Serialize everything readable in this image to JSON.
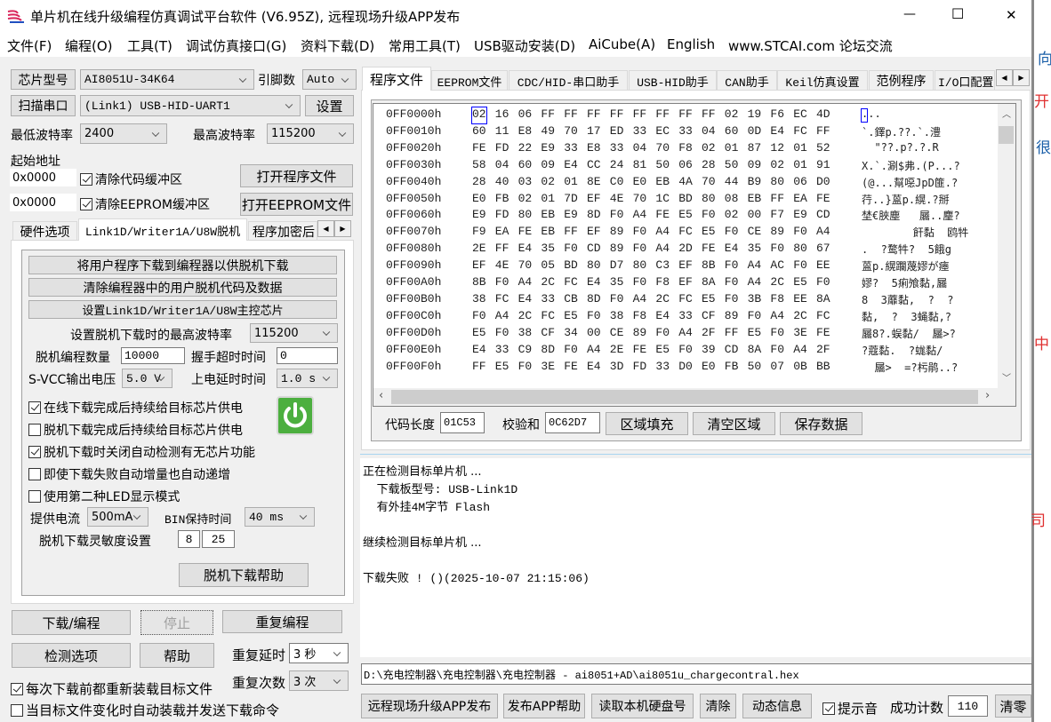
{
  "titlebar": {
    "title": "单片机在线升级编程仿真调试平台软件 (V6.95Z), 远程现场升级APP发布",
    "minimize": "—",
    "maximize": "☐",
    "close": "✕"
  },
  "menu": [
    "文件(F)",
    "编程(O)",
    "工具(T)",
    "调试仿真接口(G)",
    "资料下载(D)",
    "常用工具(T)",
    "USB驱动安装(D)",
    "AiCube(A)",
    "English",
    "www.STCAI.com 论坛交流"
  ],
  "left": {
    "chip_btn": "芯片型号",
    "chip_value": "AI8051U-34K64",
    "pins_label": "引脚数",
    "pins_value": "Auto",
    "scan_btn": "扫描串口",
    "port_value": "(Link1) USB-HID-UART1",
    "settings_btn": "设置",
    "min_baud_label": "最低波特率",
    "min_baud": "2400",
    "max_baud_label": "最高波特率",
    "max_baud": "115200",
    "start_addr_label": "起始地址",
    "code_addr": "0x0000",
    "clear_code": "清除代码缓冲区",
    "open_prog": "打开程序文件",
    "eeprom_addr": "0x0000",
    "clear_eeprom": "清除EEPROM缓冲区",
    "open_eeprom": "打开EEPROM文件",
    "tabs": [
      "硬件选项",
      "Link1D/Writer1A/U8W脱机",
      "程序加密后"
    ],
    "offline": {
      "btn1": "将用户程序下载到编程器以供脱机下载",
      "btn2": "清除编程器中的用户脱机代码及数据",
      "btn3": "设置Link1D/Writer1A/U8W主控芯片",
      "max_baud_label": "设置脱机下载时的最高波特率",
      "max_baud": "115200",
      "count_label": "脱机编程数量",
      "count": "10000",
      "handshake_label": "握手超时时间",
      "handshake": "0",
      "svcc_label": "S-VCC输出电压",
      "svcc": "5.0 V",
      "delay_label": "上电延时时间",
      "delay": "1.0 s",
      "checks": [
        {
          "label": "在线下载完成后持续给目标芯片供电",
          "checked": true
        },
        {
          "label": "脱机下载完成后持续给目标芯片供电",
          "checked": false
        },
        {
          "label": "脱机下载时关闭自动检测有无芯片功能",
          "checked": true
        },
        {
          "label": "即使下载失败自动增量也自动递增",
          "checked": false
        },
        {
          "label": "使用第二种LED显示模式",
          "checked": false
        }
      ],
      "current_label": "提供电流",
      "current": "500mA",
      "bin_label": "BIN保持时间",
      "bin": "40 ms",
      "sens_label": "脱机下载灵敏度设置",
      "sens1": "8",
      "sens2": "25",
      "help": "脱机下载帮助"
    },
    "download": "下载/编程",
    "stop": "停止",
    "repeat": "重复编程",
    "detect": "检测选项",
    "help": "帮助",
    "repeat_delay_label": "重复延时",
    "repeat_delay": "3 秒",
    "repeat_count_label": "重复次数",
    "repeat_count": "3 次",
    "reload": {
      "label": "每次下载前都重新装载目标文件",
      "checked": true
    },
    "auto_send": {
      "label": "当目标文件变化时自动装载并发送下载命令",
      "checked": false
    }
  },
  "right": {
    "tabs": [
      "程序文件",
      "EEPROM文件",
      "CDC/HID-串口助手",
      "USB-HID助手",
      "CAN助手",
      "Keil仿真设置",
      "范例程序",
      "I/O口配置"
    ],
    "hex": [
      {
        "addr": "0FF0000h",
        "bytes": [
          "02",
          "16",
          "06",
          "FF",
          "FF",
          "FF",
          "FF",
          "FF",
          "FF",
          "FF",
          "FF",
          "02",
          "19",
          "F6",
          "EC",
          "4D"
        ],
        "ascii": "..."
      },
      {
        "addr": "0FF0010h",
        "bytes": [
          "60",
          "11",
          "E8",
          "49",
          "70",
          "17",
          "ED",
          "33",
          "EC",
          "33",
          "04",
          "60",
          "0D",
          "E4",
          "FC",
          "FF"
        ],
        "ascii": "`.鐸p.??.`.澧"
      },
      {
        "addr": "0FF0020h",
        "bytes": [
          "FE",
          "FD",
          "22",
          "E9",
          "33",
          "E8",
          "33",
          "04",
          "70",
          "F8",
          "02",
          "01",
          "87",
          "12",
          "01",
          "52"
        ],
        "ascii": "  \"??.p?.?.R"
      },
      {
        "addr": "0FF0030h",
        "bytes": [
          "58",
          "04",
          "60",
          "09",
          "E4",
          "CC",
          "24",
          "81",
          "50",
          "06",
          "28",
          "50",
          "09",
          "02",
          "01",
          "91"
        ],
        "ascii": "X.`.涮$弗.(P...?"
      },
      {
        "addr": "0FF0040h",
        "bytes": [
          "28",
          "40",
          "03",
          "02",
          "01",
          "8E",
          "C0",
          "E0",
          "EB",
          "4A",
          "70",
          "44",
          "B9",
          "80",
          "06",
          "D0"
        ],
        "ascii": "(@...幫噁JpD篚.?"
      },
      {
        "addr": "0FF0050h",
        "bytes": [
          "E0",
          "FB",
          "02",
          "01",
          "7D",
          "EF",
          "4E",
          "70",
          "1C",
          "BD",
          "80",
          "08",
          "EB",
          "FF",
          "EA",
          "FE"
        ],
        "ascii": "荇..}蒕p.縨.?掰"
      },
      {
        "addr": "0FF0060h",
        "bytes": [
          "E9",
          "FD",
          "80",
          "EB",
          "E9",
          "8D",
          "F0",
          "A4",
          "FE",
          "E5",
          "F0",
          "02",
          "00",
          "F7",
          "E9",
          "CD"
        ],
        "ascii": "埜€脥塵   屫..麈?"
      },
      {
        "addr": "0FF0070h",
        "bytes": [
          "F9",
          "EA",
          "FE",
          "EB",
          "FF",
          "EF",
          "89",
          "F0",
          "A4",
          "FC",
          "E5",
          "F0",
          "CE",
          "89",
          "F0",
          "A4"
        ],
        "ascii": "        飦黏  鸥牪"
      },
      {
        "addr": "0FF0080h",
        "bytes": [
          "2E",
          "FF",
          "E4",
          "35",
          "F0",
          "CD",
          "89",
          "F0",
          "A4",
          "2D",
          "FE",
          "E4",
          "35",
          "F0",
          "80",
          "67"
        ],
        "ascii": ".  ?鹜牪?  5餓g"
      },
      {
        "addr": "0FF0090h",
        "bytes": [
          "EF",
          "4E",
          "70",
          "05",
          "BD",
          "80",
          "D7",
          "80",
          "C3",
          "EF",
          "8B",
          "F0",
          "A4",
          "AC",
          "F0",
          "EE"
        ],
        "ascii": "蒕p.縨躝蔑嫪が瘗"
      },
      {
        "addr": "0FF00A0h",
        "bytes": [
          "8B",
          "F0",
          "A4",
          "2C",
          "FC",
          "E4",
          "35",
          "F0",
          "F8",
          "EF",
          "8A",
          "F0",
          "A4",
          "2C",
          "E5",
          "F0"
        ],
        "ascii": "嫪?  5痢飧黏,屫"
      },
      {
        "addr": "0FF00B0h",
        "bytes": [
          "38",
          "FC",
          "E4",
          "33",
          "CB",
          "8D",
          "F0",
          "A4",
          "2C",
          "FC",
          "E5",
          "F0",
          "3B",
          "F8",
          "EE",
          "8A"
        ],
        "ascii": "8  3蘼黏,  ?  ?"
      },
      {
        "addr": "0FF00C0h",
        "bytes": [
          "F0",
          "A4",
          "2C",
          "FC",
          "E5",
          "F0",
          "38",
          "F8",
          "E4",
          "33",
          "CF",
          "89",
          "F0",
          "A4",
          "2C",
          "FC"
        ],
        "ascii": "黏,  ?  3蝇黏,?"
      },
      {
        "addr": "0FF00D0h",
        "bytes": [
          "E5",
          "F0",
          "38",
          "CF",
          "34",
          "00",
          "CE",
          "89",
          "F0",
          "A4",
          "2F",
          "FF",
          "E5",
          "F0",
          "3E",
          "FE"
        ],
        "ascii": "屫8?.蜈黏/  屫>?"
      },
      {
        "addr": "0FF00E0h",
        "bytes": [
          "E4",
          "33",
          "C9",
          "8D",
          "F0",
          "A4",
          "2E",
          "FE",
          "E5",
          "F0",
          "39",
          "CD",
          "8A",
          "F0",
          "A4",
          "2F"
        ],
        "ascii": "?蔻黏.  ?蛖黏/"
      },
      {
        "addr": "0FF00F0h",
        "bytes": [
          "FF",
          "E5",
          "F0",
          "3E",
          "FE",
          "E4",
          "3D",
          "FD",
          "33",
          "D0",
          "E0",
          "FB",
          "50",
          "07",
          "0B",
          "BB"
        ],
        "ascii": "  屫>  =?杇鹃..?"
      }
    ],
    "code_len_label": "代码长度",
    "code_len": "01C53",
    "checksum_label": "校验和",
    "checksum": "0C62D7",
    "fill_btn": "区域填充",
    "clear_btn": "清空区域",
    "save_btn": "保存数据",
    "log": [
      "正在检测目标单片机 ...",
      "  下载板型号: USB-Link1D",
      "  有外挂4M字节 Flash",
      "",
      "继续检测目标单片机 ...",
      "",
      "下载失败 ! ()(2025-10-07 21:15:06)"
    ],
    "path": "D:\\充电控制器\\充电控制器\\充电控制器 - ai8051+AD\\ai8051u_chargecontral.hex",
    "publish_btn": "远程现场升级APP发布",
    "publish_help_btn": "发布APP帮助",
    "read_disk_btn": "读取本机硬盘号",
    "clear_log_btn": "清除",
    "dyn_info_btn": "动态信息",
    "beep": {
      "label": "提示音",
      "checked": true
    },
    "success_label": "成功计数",
    "success_count": "110",
    "reset_btn": "清零"
  },
  "background_window": {
    "glyphs": [
      "向",
      "开",
      "很",
      "中",
      "司"
    ]
  },
  "colors": {
    "power_green": "#4caf3f",
    "accent_blue": "#0000ff",
    "red_text": "#e03030",
    "blue_text": "#1a5fa8"
  }
}
